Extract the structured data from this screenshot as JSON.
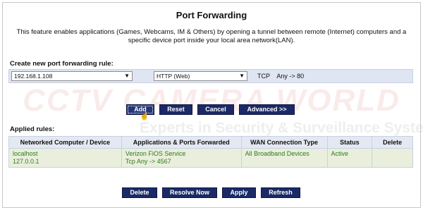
{
  "page": {
    "title": "Port Forwarding",
    "description_line1": "This feature enables applications (Games, Webcams, IM & Others) by opening a tunnel between remote (Internet) computers and a",
    "description_line2": "specific device port inside your local area network(LAN)."
  },
  "create_rule": {
    "label": "Create new port forwarding rule:",
    "device_value": "192.168.1.108",
    "application_value": "HTTP (Web)",
    "protocol_text": "TCP    Any -> 80"
  },
  "buttons": {
    "add": "Add",
    "reset": "Reset",
    "cancel": "Cancel",
    "advanced": "Advanced >>",
    "delete": "Delete",
    "resolve_now": "Resolve Now",
    "apply": "Apply",
    "refresh": "Refresh"
  },
  "applied_rules": {
    "label": "Applied rules:",
    "columns": [
      "Networked Computer / Device",
      "Applications & Ports Forwarded",
      "WAN Connection Type",
      "Status",
      "Delete"
    ],
    "rows": [
      {
        "device_name": "localhost",
        "device_ip": "127.0.0.1",
        "application": "Verizon FiOS Service",
        "ports": "Tcp Any -> 4567",
        "wan": "All Broadband Devices",
        "status": "Active",
        "delete": ""
      }
    ]
  },
  "watermark": {
    "main": "CCTV CAMERA WORLD",
    "sub": "Experts in Security & Surveillance Systems"
  },
  "icons": {
    "dropdown": "chevron-down-icon",
    "cursor": "hand-pointer-icon"
  },
  "colors": {
    "button_bg": "#1b2a66",
    "rule_bar_bg": "#dfe5f2",
    "row_bg": "#e9efdc",
    "row_text": "#2f7a1a"
  }
}
